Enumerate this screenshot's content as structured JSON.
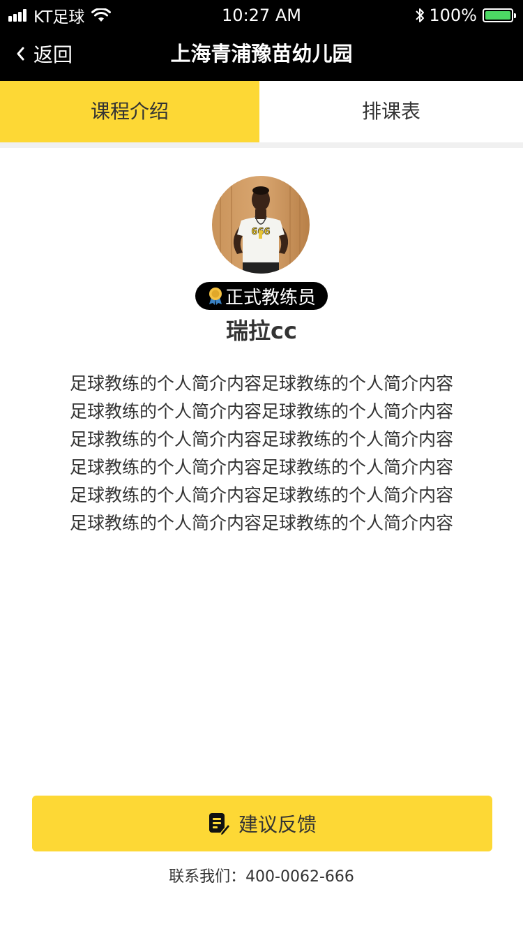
{
  "status_bar": {
    "carrier": "KT足球",
    "time": "10:27 AM",
    "battery": "100%",
    "battery_level": 1.0,
    "signal_icon": "signal-icon",
    "wifi_icon": "wifi-icon",
    "bluetooth_icon": "bluetooth-icon"
  },
  "nav": {
    "back_label": "返回",
    "title": "上海青浦豫苗幼儿园"
  },
  "tabs": [
    {
      "label": "课程介绍",
      "active": true
    },
    {
      "label": "排课表",
      "active": false
    }
  ],
  "coach": {
    "badge": "正式教练员",
    "name": "瑞拉cc",
    "bio_lines": [
      "足球教练的个人简介内容足球教练的个人简介内容",
      "足球教练的个人简介内容足球教练的个人简介内容",
      "足球教练的个人简介内容足球教练的个人简介内容",
      "足球教练的个人简介内容足球教练的个人简介内容",
      "足球教练的个人简介内容足球教练的个人简介内容",
      "足球教练的个人简介内容足球教练的个人简介内容"
    ]
  },
  "feedback": {
    "label": "建议反馈",
    "contact": "联系我们：400-0062-666"
  },
  "colors": {
    "accent": "#fdd835",
    "header_bg": "#000000",
    "text": "#333333"
  }
}
